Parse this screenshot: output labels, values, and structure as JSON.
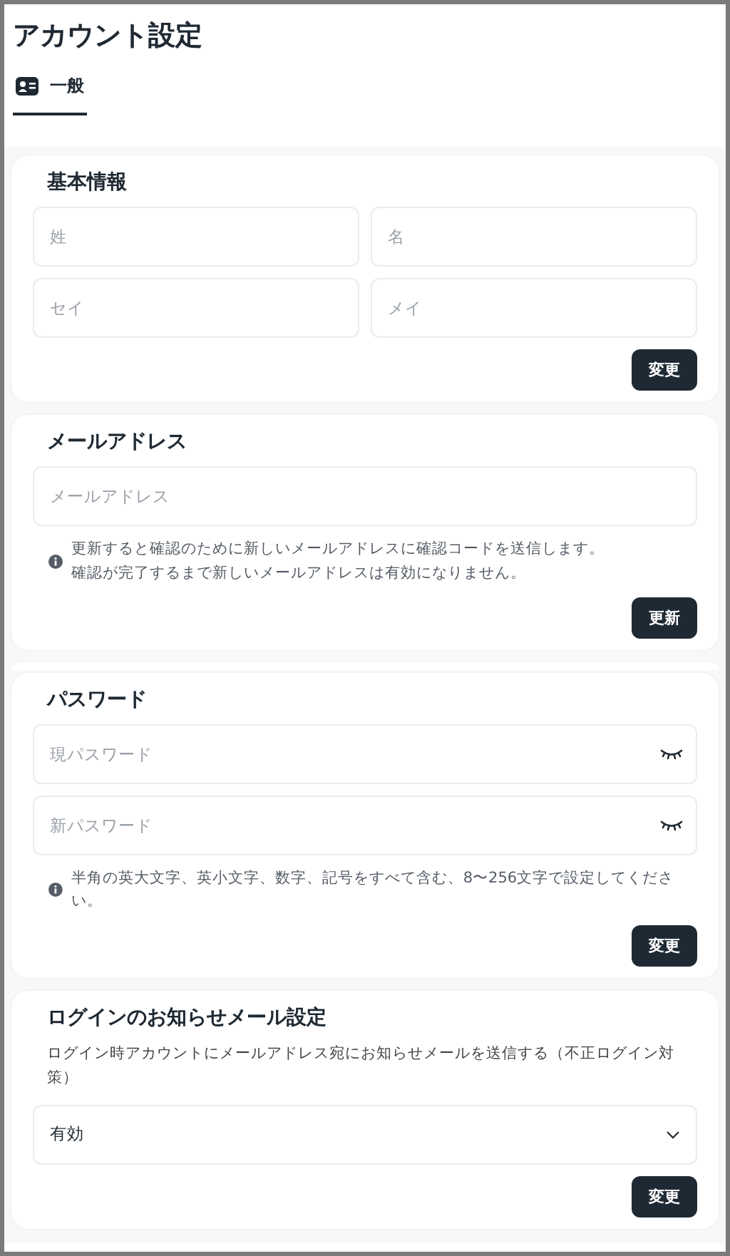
{
  "page": {
    "title": "アカウント設定"
  },
  "tabs": [
    {
      "label": "一般",
      "selected": true
    }
  ],
  "sections": [
    {
      "kind": "form",
      "title": "基本情報",
      "fields": [
        {
          "kind": "text",
          "placeholder": "姓"
        },
        {
          "kind": "text",
          "placeholder": "名"
        },
        {
          "kind": "text",
          "placeholder": "セイ"
        },
        {
          "kind": "text",
          "placeholder": "メイ"
        }
      ],
      "button": "変更"
    },
    {
      "kind": "form",
      "title": "メールアドレス",
      "fields": [
        {
          "kind": "text",
          "placeholder": "メールアドレス"
        }
      ],
      "note": [
        "更新すると確認のために新しいメールアドレスに確認コードを送信します。",
        "確認が完了するまで新しいメールアドレスは有効になりません。"
      ],
      "button": "更新"
    },
    {
      "kind": "empty"
    },
    {
      "kind": "form",
      "title": "パスワード",
      "fields": [
        {
          "kind": "password",
          "placeholder": "現パスワード"
        },
        {
          "kind": "password",
          "placeholder": "新パスワード"
        }
      ],
      "note": [
        "半角の英大文字、英小文字、数字、記号をすべて含む、8〜256文字で設定してください。"
      ],
      "button": "変更"
    },
    {
      "kind": "form",
      "title": "ログインのお知らせメール設定",
      "description": "ログイン時アカウントにメールアドレス宛にお知らせメールを送信する（不正ログイン対策）",
      "fields": [
        {
          "kind": "select",
          "value": "有効"
        }
      ],
      "button": "変更"
    }
  ]
}
